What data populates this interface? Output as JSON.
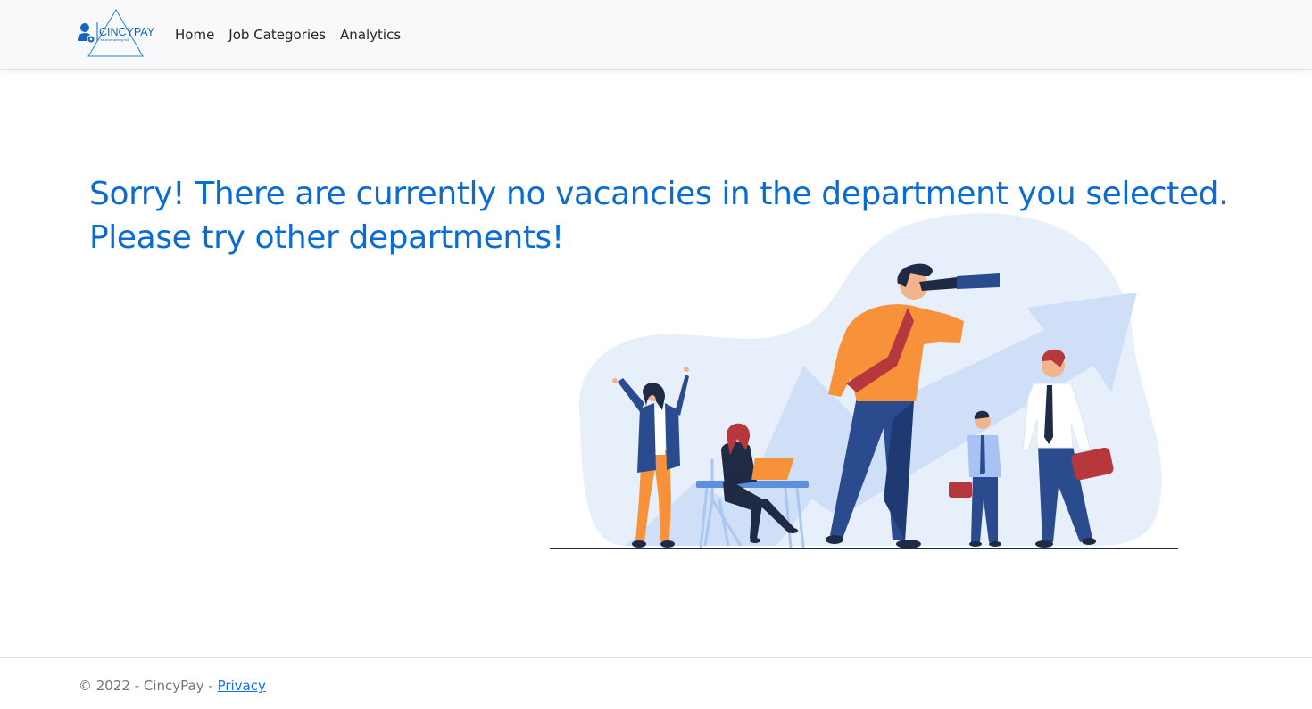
{
  "navbar": {
    "logo": {
      "brand_name": "CINCYPAY",
      "tagline": "The smart working hub",
      "icon": "user-gear-icon"
    },
    "links": [
      {
        "label": "Home"
      },
      {
        "label": "Job Categories"
      },
      {
        "label": "Analytics"
      }
    ]
  },
  "main": {
    "message_line1": "Sorry! There are currently no vacancies in the department you selected.",
    "message_line2": "Please try other departments!",
    "illustration": "team-searching-with-telescope"
  },
  "footer": {
    "copyright": "© 2022 - CincyPay - ",
    "privacy_label": "Privacy"
  },
  "colors": {
    "accent": "#0a6cd3",
    "navbar_bg": "#f8f9fa",
    "link": "#0d6efd",
    "figure_orange": "#f7923b",
    "figure_navy": "#2a4b8d",
    "figure_red": "#b7383c",
    "background_blob": "#e6effb"
  }
}
